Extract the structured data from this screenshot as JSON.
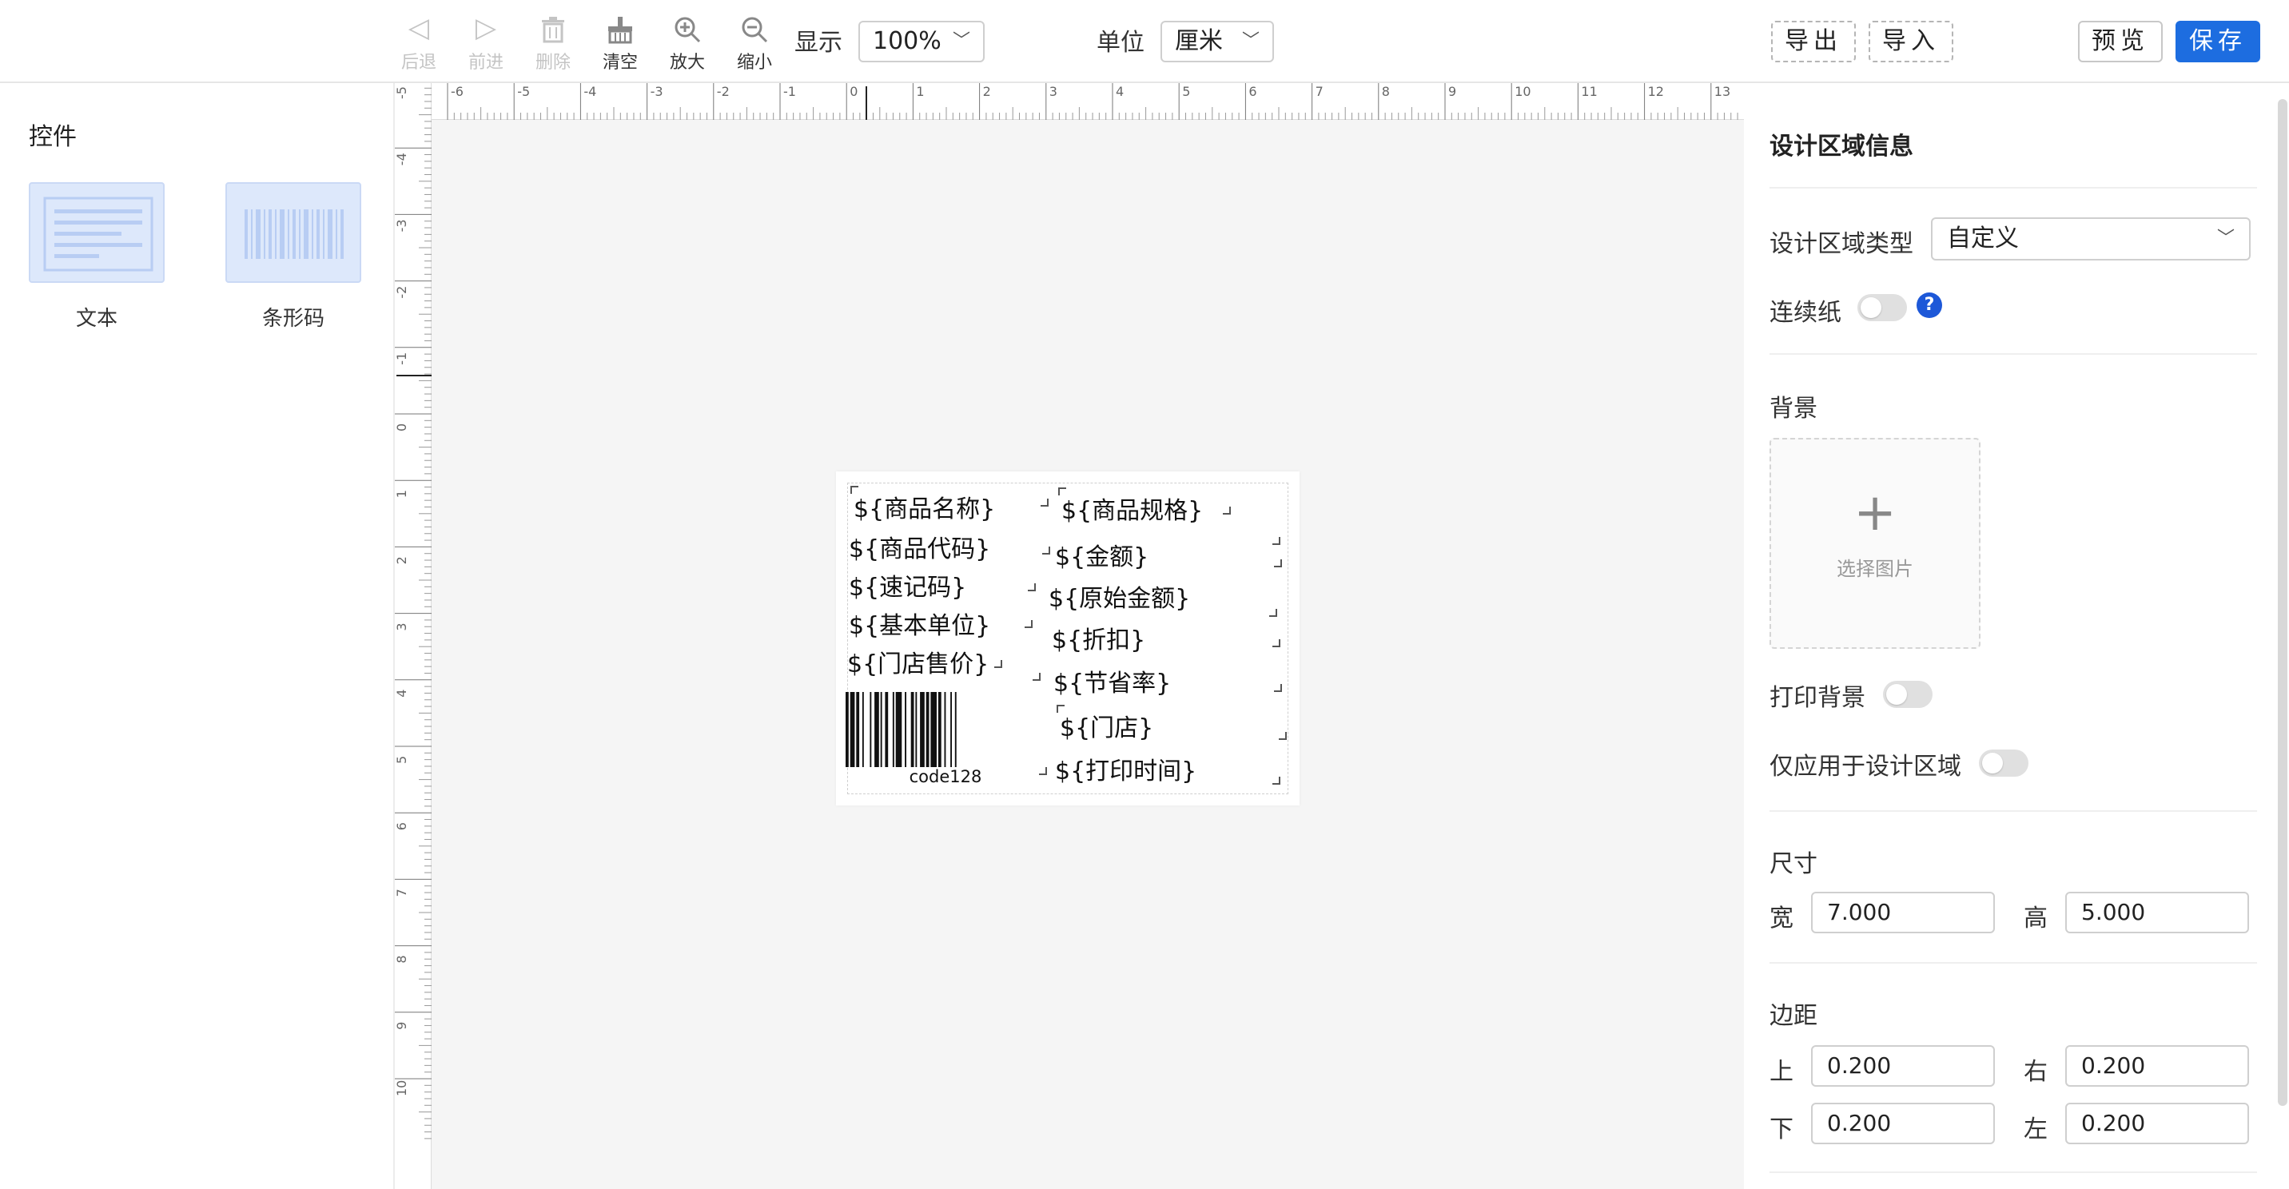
{
  "toolbar": {
    "tools": [
      {
        "label": "后退",
        "icon": "triangle-left-icon",
        "disabled": true
      },
      {
        "label": "前进",
        "icon": "triangle-right-icon",
        "disabled": true
      },
      {
        "label": "删除",
        "icon": "trash-icon",
        "disabled": true
      },
      {
        "label": "清空",
        "icon": "broom-icon",
        "disabled": false
      },
      {
        "label": "放大",
        "icon": "zoom-in-icon",
        "disabled": false
      },
      {
        "label": "缩小",
        "icon": "zoom-out-icon",
        "disabled": false
      }
    ],
    "display_label": "显示",
    "zoom_value": "100%",
    "unit_label": "单位",
    "unit_value": "厘米",
    "export_label": "导出",
    "import_label": "导入",
    "preview_label": "预览",
    "save_label": "保存",
    "accent_color": "#1d6de0"
  },
  "left_panel": {
    "title": "控件",
    "widgets": [
      {
        "label": "文本",
        "icon": "text-widget-icon"
      },
      {
        "label": "条形码",
        "icon": "barcode-widget-icon"
      }
    ]
  },
  "canvas": {
    "ruler_top_labels": [
      "-6",
      "-5",
      "-4",
      "-3",
      "-2",
      "-1",
      "0",
      "1",
      "2",
      "3",
      "4",
      "5",
      "6",
      "7",
      "8",
      "9",
      "10",
      "11",
      "12",
      "13"
    ],
    "ruler_left_labels": [
      "-5",
      "-4",
      "-3",
      "-2",
      "-1",
      "0",
      "1",
      "2",
      "3",
      "4",
      "5",
      "6",
      "7",
      "8",
      "9",
      "10"
    ],
    "fields": [
      "${商品名称}",
      "${商品代码}",
      "${速记码}",
      "${基本单位}",
      "${门店售价}",
      "${商品规格}",
      "${金额}",
      "${原始金额}",
      "${折扣}",
      "${节省率}",
      "${门店}",
      "${打印时间}"
    ],
    "barcode_caption": "code128"
  },
  "right_panel": {
    "title": "设计区域信息",
    "area_type_label": "设计区域类型",
    "area_type_value": "自定义",
    "continuous_paper_label": "连续纸",
    "help_icon_text": "?",
    "background_label": "背景",
    "choose_image_label": "选择图片",
    "print_background_label": "打印背景",
    "apply_area_only_label": "仅应用于设计区域",
    "size_label": "尺寸",
    "width_label": "宽",
    "width_value": "7.000",
    "height_label": "高",
    "height_value": "5.000",
    "margin_label": "边距",
    "margin_top_label": "上",
    "margin_top_value": "0.200",
    "margin_right_label": "右",
    "margin_right_value": "0.200",
    "margin_bottom_label": "下",
    "margin_bottom_value": "0.200",
    "margin_left_label": "左",
    "margin_left_value": "0.200"
  }
}
